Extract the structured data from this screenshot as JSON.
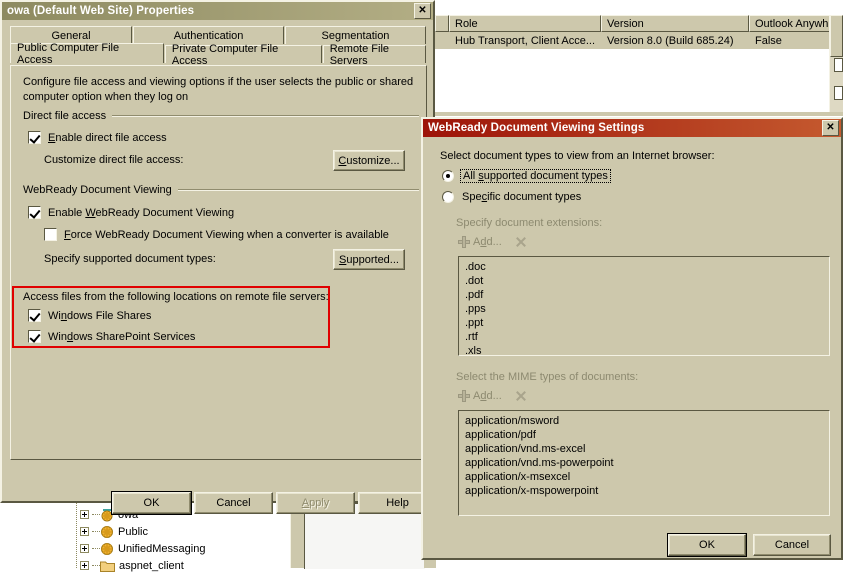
{
  "background": {
    "result_pane": {
      "columns": [
        "Role",
        "Version",
        "Outlook Anywh"
      ],
      "rows": [
        {
          "role": "Hub Transport, Client Acce...",
          "version": "Version 8.0 (Build 685.24)",
          "outlook_anywhere": "False"
        }
      ]
    },
    "tree": {
      "items": [
        {
          "label": "owa",
          "icon": "web-application-icon"
        },
        {
          "label": "Public",
          "icon": "web-application-icon"
        },
        {
          "label": "UnifiedMessaging",
          "icon": "web-application-icon"
        },
        {
          "label": "aspnet_client",
          "icon": "folder-icon"
        }
      ]
    }
  },
  "dialog1": {
    "title": "owa (Default Web Site) Properties",
    "close_label": "✕",
    "tabs_row1": [
      {
        "label": "General",
        "selected": false
      },
      {
        "label": "Authentication",
        "selected": false
      },
      {
        "label": "Segmentation",
        "selected": false
      }
    ],
    "tabs_row2": [
      {
        "label": "Public Computer File Access",
        "selected": true
      },
      {
        "label": "Private Computer File Access",
        "selected": false
      },
      {
        "label": "Remote File Servers",
        "selected": false
      }
    ],
    "description": "Configure file access and viewing options if the user selects the public or shared computer option when they log on",
    "group_direct": {
      "title": "Direct file access",
      "enable_checkbox": {
        "label_pre": "",
        "label_accel": "E",
        "label_post": "nable direct file access",
        "checked": true
      },
      "customize_label": "Customize direct file access:",
      "customize_button": {
        "pre": "",
        "accel": "C",
        "post": "ustomize..."
      }
    },
    "group_webready": {
      "title": "WebReady Document Viewing",
      "enable_checkbox": {
        "pre": "Enable ",
        "accel": "W",
        "post": "ebReady Document Viewing",
        "checked": true
      },
      "force_checkbox": {
        "pre": "",
        "accel": "F",
        "post": "orce WebReady Document Viewing when a converter is available",
        "checked": false
      },
      "supported_label": "Specify supported document types:",
      "supported_button": {
        "pre": "",
        "accel": "S",
        "post": "upported..."
      }
    },
    "remote_locations": {
      "title": "Access files from the following locations on remote file servers:",
      "highlight_color": "#e00000",
      "checkboxes": [
        {
          "pre": "Wi",
          "accel": "n",
          "post": "dows File Shares",
          "checked": true
        },
        {
          "pre": "Win",
          "accel": "d",
          "post": "ows SharePoint Services",
          "checked": true
        }
      ]
    },
    "buttons": [
      {
        "label": "OK",
        "default": true,
        "disabled": false
      },
      {
        "label": "Cancel",
        "default": false,
        "disabled": false
      },
      {
        "label": "Apply",
        "default": false,
        "disabled": true
      },
      {
        "label": "Help",
        "default": false,
        "disabled": false
      }
    ]
  },
  "dialog2": {
    "title": "WebReady Document Viewing Settings",
    "close_label": "✕",
    "title_color": "#9d1409",
    "instruction": "Select document types to view from an Internet browser:",
    "radios": [
      {
        "pre": "All ",
        "accel": "s",
        "post": "upported document types",
        "selected": true,
        "focused": true
      },
      {
        "pre": "Spe",
        "accel": "c",
        "post": "ific document types",
        "selected": false,
        "focused": false
      }
    ],
    "extensions_section": {
      "label": "Specify document extensions:",
      "add_button": {
        "pre": "A",
        "accel": "d",
        "post": "d..."
      },
      "delete_icon": "delete-x-icon",
      "items": [
        ".doc",
        ".dot",
        ".pdf",
        ".pps",
        ".ppt",
        ".rtf",
        ".xls"
      ]
    },
    "mime_section": {
      "label": "Select the MIME types of documents:",
      "add_button": {
        "pre": "A",
        "accel": "d",
        "post": "d..."
      },
      "delete_icon": "delete-x-icon",
      "items": [
        "application/msword",
        "application/pdf",
        "application/vnd.ms-excel",
        "application/vnd.ms-powerpoint",
        "application/x-msexcel",
        "application/x-mspowerpoint"
      ]
    },
    "buttons": [
      {
        "label": "OK",
        "default": true
      },
      {
        "label": "Cancel",
        "default": false
      }
    ]
  }
}
